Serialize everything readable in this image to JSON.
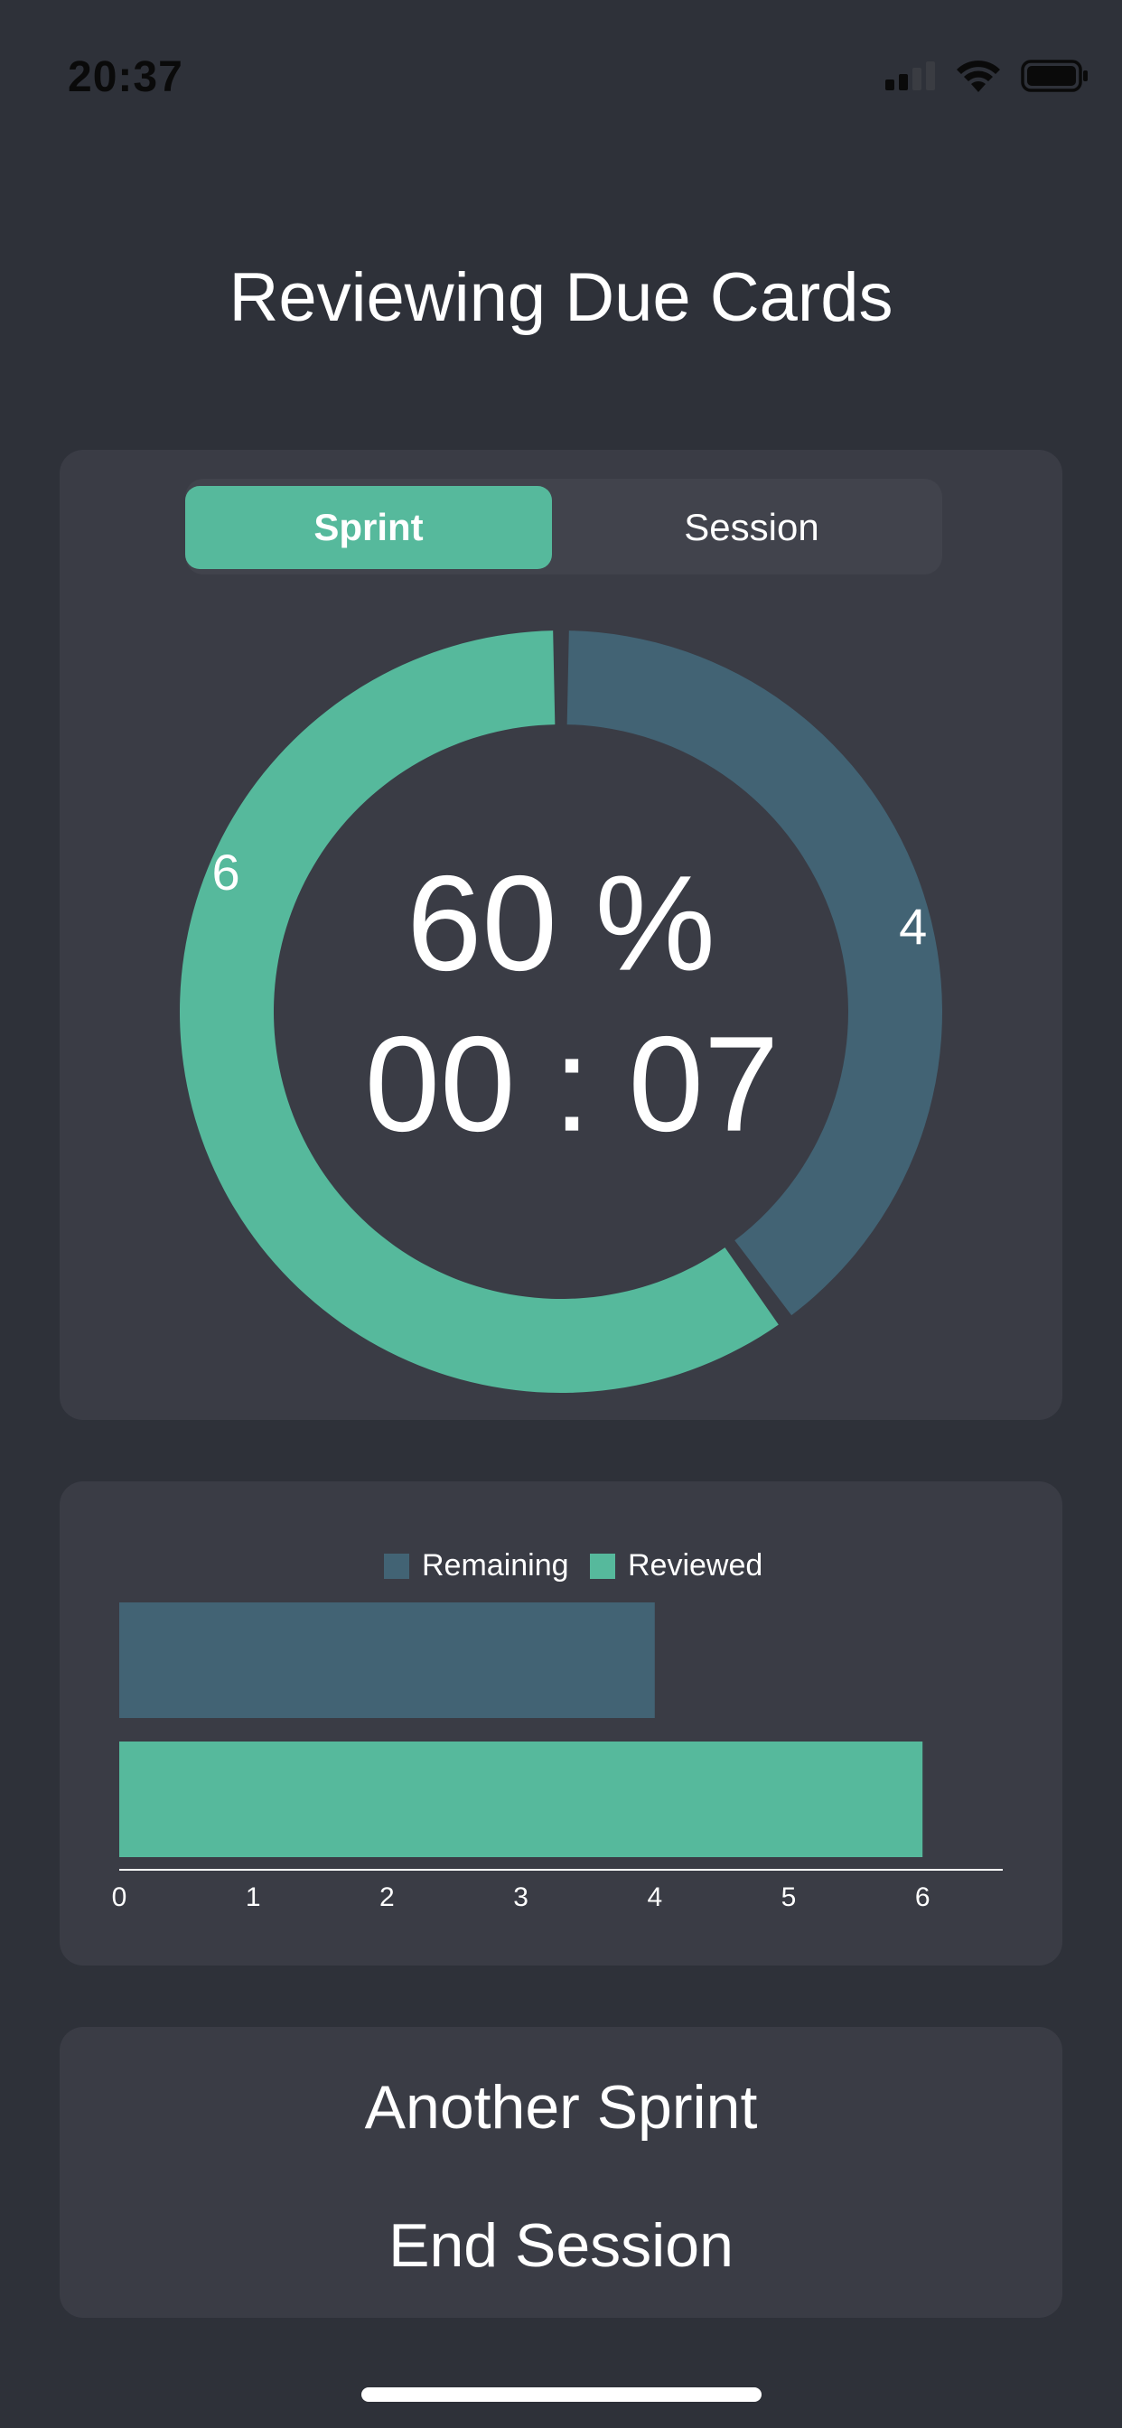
{
  "status_bar": {
    "time": "20:37",
    "icons": [
      "cellular-signal-icon",
      "wifi-icon",
      "battery-icon"
    ]
  },
  "title": "Reviewing Due Cards",
  "segmented": {
    "options": [
      "Sprint",
      "Session"
    ],
    "selected": "Sprint"
  },
  "donut": {
    "percent_text": "60 %",
    "timer_text": "00 : 07",
    "reviewed_value": 6,
    "remaining_value": 4,
    "reviewed_label": "6",
    "remaining_label": "4"
  },
  "colors": {
    "reviewed": "#56b99c",
    "remaining": "#426374",
    "background": "#2e3139",
    "card": "#3a3c45"
  },
  "chart_data": {
    "type": "bar",
    "orientation": "horizontal",
    "categories": [
      "Remaining",
      "Reviewed"
    ],
    "series": [
      {
        "name": "Remaining",
        "values": [
          4
        ]
      },
      {
        "name": "Reviewed",
        "values": [
          6
        ]
      }
    ],
    "values": [
      4,
      6
    ],
    "legend": [
      "Remaining",
      "Reviewed"
    ],
    "xlim": [
      0,
      6.6
    ],
    "ticks": [
      "0",
      "1",
      "2",
      "3",
      "4",
      "5",
      "6"
    ],
    "grid": false,
    "legend_position": "top-center"
  },
  "actions": {
    "another_sprint": "Another Sprint",
    "end_session": "End Session"
  }
}
